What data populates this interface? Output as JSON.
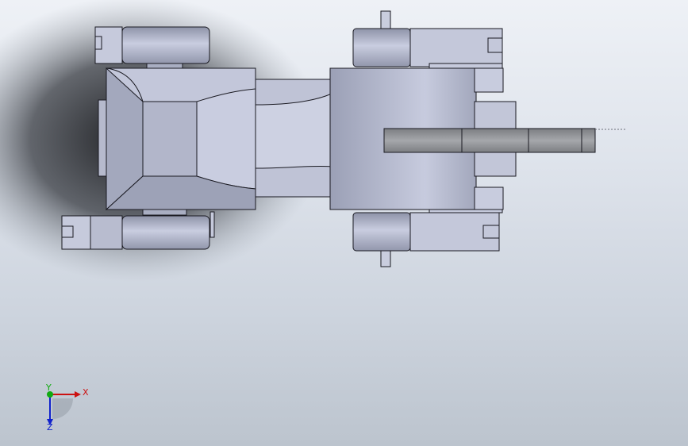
{
  "triad": {
    "x_label": "X",
    "y_label": "Y",
    "z_label": "Z",
    "x_color": "#cc1111",
    "y_color": "#11aa11",
    "z_color": "#1122cc"
  },
  "colors": {
    "body_light": "#c8ccdc",
    "body_mid": "#a6abc0",
    "body_dark": "#7e8398",
    "shadow": "#1c1e22",
    "arm": "#8d9094"
  }
}
